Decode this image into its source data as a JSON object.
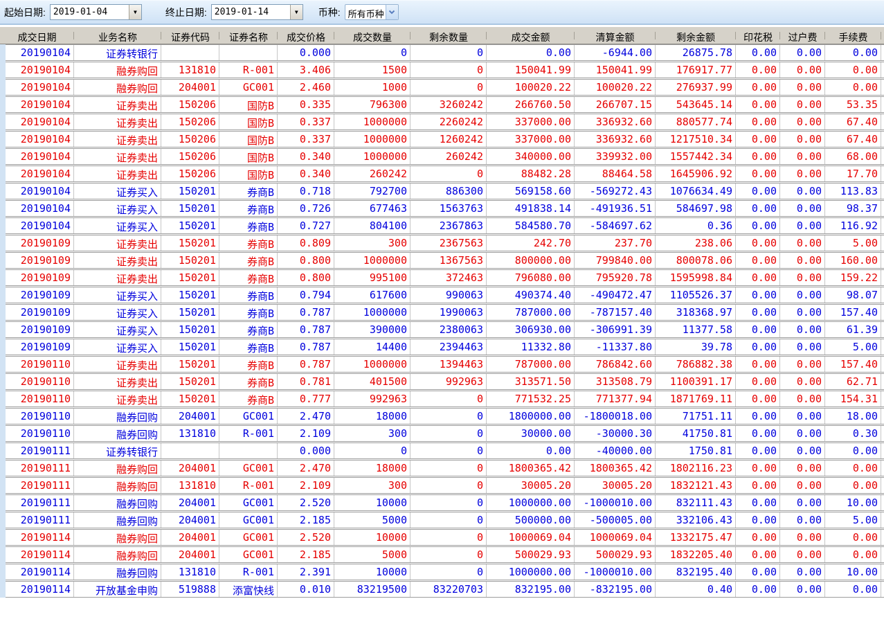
{
  "toolbar": {
    "start_date_label": "起始日期:",
    "start_date_value": "2019-01-04",
    "end_date_label": "终止日期:",
    "end_date_value": "2019-01-14",
    "currency_label": "币种:",
    "currency_value": "所有币种"
  },
  "colors": {
    "sell_red": "#e60000",
    "buy_blue": "#0000dd",
    "header_bg": "#d6d2c9",
    "toolbar_bg": "#d9eafa",
    "gutter_blue": "#d2e3f4"
  },
  "table": {
    "columns": [
      "成交日期",
      "业务名称",
      "证券代码",
      "证券名称",
      "成交价格",
      "成交数量",
      "剩余数量",
      "成交金额",
      "清算金额",
      "剩余金额",
      "印花税",
      "过户费",
      "手续费"
    ],
    "column_keys": [
      "trade-date",
      "business-name",
      "security-code",
      "security-name",
      "price",
      "quantity",
      "remaining-quantity",
      "amount",
      "clearing-amount",
      "remaining-amount",
      "stamp-tax",
      "transfer-fee",
      "commission"
    ],
    "rows": [
      {
        "color": "blue",
        "v": [
          "20190104",
          "证券转银行",
          "",
          "",
          "0.000",
          "0",
          "0",
          "0.00",
          "-6944.00",
          "26875.78",
          "0.00",
          "0.00",
          "0.00"
        ]
      },
      {
        "color": "red",
        "v": [
          "20190104",
          "融券购回",
          "131810",
          "R-001",
          "3.406",
          "1500",
          "0",
          "150041.99",
          "150041.99",
          "176917.77",
          "0.00",
          "0.00",
          "0.00"
        ]
      },
      {
        "color": "red",
        "v": [
          "20190104",
          "融券购回",
          "204001",
          "GC001",
          "2.460",
          "1000",
          "0",
          "100020.22",
          "100020.22",
          "276937.99",
          "0.00",
          "0.00",
          "0.00"
        ]
      },
      {
        "color": "red",
        "v": [
          "20190104",
          "证券卖出",
          "150206",
          "国防B",
          "0.335",
          "796300",
          "3260242",
          "266760.50",
          "266707.15",
          "543645.14",
          "0.00",
          "0.00",
          "53.35"
        ]
      },
      {
        "color": "red",
        "v": [
          "20190104",
          "证券卖出",
          "150206",
          "国防B",
          "0.337",
          "1000000",
          "2260242",
          "337000.00",
          "336932.60",
          "880577.74",
          "0.00",
          "0.00",
          "67.40"
        ]
      },
      {
        "color": "red",
        "v": [
          "20190104",
          "证券卖出",
          "150206",
          "国防B",
          "0.337",
          "1000000",
          "1260242",
          "337000.00",
          "336932.60",
          "1217510.34",
          "0.00",
          "0.00",
          "67.40"
        ]
      },
      {
        "color": "red",
        "v": [
          "20190104",
          "证券卖出",
          "150206",
          "国防B",
          "0.340",
          "1000000",
          "260242",
          "340000.00",
          "339932.00",
          "1557442.34",
          "0.00",
          "0.00",
          "68.00"
        ]
      },
      {
        "color": "red",
        "v": [
          "20190104",
          "证券卖出",
          "150206",
          "国防B",
          "0.340",
          "260242",
          "0",
          "88482.28",
          "88464.58",
          "1645906.92",
          "0.00",
          "0.00",
          "17.70"
        ]
      },
      {
        "color": "blue",
        "v": [
          "20190104",
          "证券买入",
          "150201",
          "券商B",
          "0.718",
          "792700",
          "886300",
          "569158.60",
          "-569272.43",
          "1076634.49",
          "0.00",
          "0.00",
          "113.83"
        ]
      },
      {
        "color": "blue",
        "v": [
          "20190104",
          "证券买入",
          "150201",
          "券商B",
          "0.726",
          "677463",
          "1563763",
          "491838.14",
          "-491936.51",
          "584697.98",
          "0.00",
          "0.00",
          "98.37"
        ]
      },
      {
        "color": "blue",
        "v": [
          "20190104",
          "证券买入",
          "150201",
          "券商B",
          "0.727",
          "804100",
          "2367863",
          "584580.70",
          "-584697.62",
          "0.36",
          "0.00",
          "0.00",
          "116.92"
        ]
      },
      {
        "color": "red",
        "v": [
          "20190109",
          "证券卖出",
          "150201",
          "券商B",
          "0.809",
          "300",
          "2367563",
          "242.70",
          "237.70",
          "238.06",
          "0.00",
          "0.00",
          "5.00"
        ]
      },
      {
        "color": "red",
        "v": [
          "20190109",
          "证券卖出",
          "150201",
          "券商B",
          "0.800",
          "1000000",
          "1367563",
          "800000.00",
          "799840.00",
          "800078.06",
          "0.00",
          "0.00",
          "160.00"
        ]
      },
      {
        "color": "red",
        "v": [
          "20190109",
          "证券卖出",
          "150201",
          "券商B",
          "0.800",
          "995100",
          "372463",
          "796080.00",
          "795920.78",
          "1595998.84",
          "0.00",
          "0.00",
          "159.22"
        ]
      },
      {
        "color": "blue",
        "v": [
          "20190109",
          "证券买入",
          "150201",
          "券商B",
          "0.794",
          "617600",
          "990063",
          "490374.40",
          "-490472.47",
          "1105526.37",
          "0.00",
          "0.00",
          "98.07"
        ]
      },
      {
        "color": "blue",
        "v": [
          "20190109",
          "证券买入",
          "150201",
          "券商B",
          "0.787",
          "1000000",
          "1990063",
          "787000.00",
          "-787157.40",
          "318368.97",
          "0.00",
          "0.00",
          "157.40"
        ]
      },
      {
        "color": "blue",
        "v": [
          "20190109",
          "证券买入",
          "150201",
          "券商B",
          "0.787",
          "390000",
          "2380063",
          "306930.00",
          "-306991.39",
          "11377.58",
          "0.00",
          "0.00",
          "61.39"
        ]
      },
      {
        "color": "blue",
        "v": [
          "20190109",
          "证券买入",
          "150201",
          "券商B",
          "0.787",
          "14400",
          "2394463",
          "11332.80",
          "-11337.80",
          "39.78",
          "0.00",
          "0.00",
          "5.00"
        ]
      },
      {
        "color": "red",
        "v": [
          "20190110",
          "证券卖出",
          "150201",
          "券商B",
          "0.787",
          "1000000",
          "1394463",
          "787000.00",
          "786842.60",
          "786882.38",
          "0.00",
          "0.00",
          "157.40"
        ]
      },
      {
        "color": "red",
        "v": [
          "20190110",
          "证券卖出",
          "150201",
          "券商B",
          "0.781",
          "401500",
          "992963",
          "313571.50",
          "313508.79",
          "1100391.17",
          "0.00",
          "0.00",
          "62.71"
        ]
      },
      {
        "color": "red",
        "v": [
          "20190110",
          "证券卖出",
          "150201",
          "券商B",
          "0.777",
          "992963",
          "0",
          "771532.25",
          "771377.94",
          "1871769.11",
          "0.00",
          "0.00",
          "154.31"
        ]
      },
      {
        "color": "blue",
        "v": [
          "20190110",
          "融券回购",
          "204001",
          "GC001",
          "2.470",
          "18000",
          "0",
          "1800000.00",
          "-1800018.00",
          "71751.11",
          "0.00",
          "0.00",
          "18.00"
        ]
      },
      {
        "color": "blue",
        "v": [
          "20190110",
          "融券回购",
          "131810",
          "R-001",
          "2.109",
          "300",
          "0",
          "30000.00",
          "-30000.30",
          "41750.81",
          "0.00",
          "0.00",
          "0.30"
        ]
      },
      {
        "color": "blue",
        "v": [
          "20190111",
          "证券转银行",
          "",
          "",
          "0.000",
          "0",
          "0",
          "0.00",
          "-40000.00",
          "1750.81",
          "0.00",
          "0.00",
          "0.00"
        ]
      },
      {
        "color": "red",
        "v": [
          "20190111",
          "融券购回",
          "204001",
          "GC001",
          "2.470",
          "18000",
          "0",
          "1800365.42",
          "1800365.42",
          "1802116.23",
          "0.00",
          "0.00",
          "0.00"
        ]
      },
      {
        "color": "red",
        "v": [
          "20190111",
          "融券购回",
          "131810",
          "R-001",
          "2.109",
          "300",
          "0",
          "30005.20",
          "30005.20",
          "1832121.43",
          "0.00",
          "0.00",
          "0.00"
        ]
      },
      {
        "color": "blue",
        "v": [
          "20190111",
          "融券回购",
          "204001",
          "GC001",
          "2.520",
          "10000",
          "0",
          "1000000.00",
          "-1000010.00",
          "832111.43",
          "0.00",
          "0.00",
          "10.00"
        ]
      },
      {
        "color": "blue",
        "v": [
          "20190111",
          "融券回购",
          "204001",
          "GC001",
          "2.185",
          "5000",
          "0",
          "500000.00",
          "-500005.00",
          "332106.43",
          "0.00",
          "0.00",
          "5.00"
        ]
      },
      {
        "color": "red",
        "v": [
          "20190114",
          "融券购回",
          "204001",
          "GC001",
          "2.520",
          "10000",
          "0",
          "1000069.04",
          "1000069.04",
          "1332175.47",
          "0.00",
          "0.00",
          "0.00"
        ]
      },
      {
        "color": "red",
        "v": [
          "20190114",
          "融券购回",
          "204001",
          "GC001",
          "2.185",
          "5000",
          "0",
          "500029.93",
          "500029.93",
          "1832205.40",
          "0.00",
          "0.00",
          "0.00"
        ]
      },
      {
        "color": "blue",
        "v": [
          "20190114",
          "融券回购",
          "131810",
          "R-001",
          "2.391",
          "10000",
          "0",
          "1000000.00",
          "-1000010.00",
          "832195.40",
          "0.00",
          "0.00",
          "10.00"
        ]
      },
      {
        "color": "blue",
        "v": [
          "20190114",
          "开放基金申购",
          "519888",
          "添富快线",
          "0.010",
          "83219500",
          "83220703",
          "832195.00",
          "-832195.00",
          "0.40",
          "0.00",
          "0.00",
          "0.00"
        ]
      }
    ]
  }
}
